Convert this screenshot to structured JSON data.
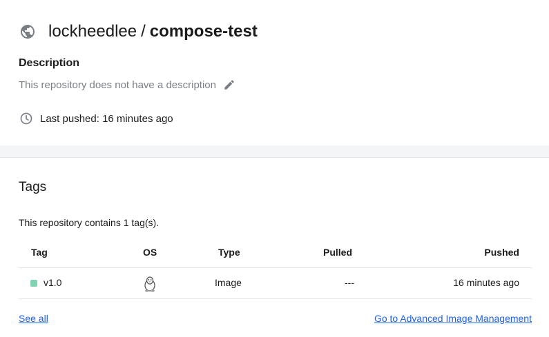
{
  "repo": {
    "namespace": "lockheedlee",
    "separator": "/",
    "name": "compose-test",
    "visibility_icon": "globe-icon"
  },
  "description": {
    "title": "Description",
    "text": "This repository does not have a description",
    "edit_icon": "pencil-icon"
  },
  "last_pushed": {
    "icon": "clock-icon",
    "text": "Last pushed: 16 minutes ago"
  },
  "tags": {
    "title": "Tags",
    "count_text": "This repository contains 1 tag(s).",
    "columns": {
      "tag": "Tag",
      "os": "OS",
      "type": "Type",
      "pulled": "Pulled",
      "pushed": "Pushed"
    },
    "rows": [
      {
        "tag": "v1.0",
        "os_icon": "linux-tux-icon",
        "type": "Image",
        "pulled": "---",
        "pushed": "16 minutes ago",
        "status_color": "#7fd3b2"
      }
    ]
  },
  "links": {
    "see_all": "See all",
    "advanced": "Go to Advanced Image Management"
  },
  "colors": {
    "link": "#1d63ed",
    "muted_text": "#7a7e85",
    "divider": "#e3e5e8"
  }
}
